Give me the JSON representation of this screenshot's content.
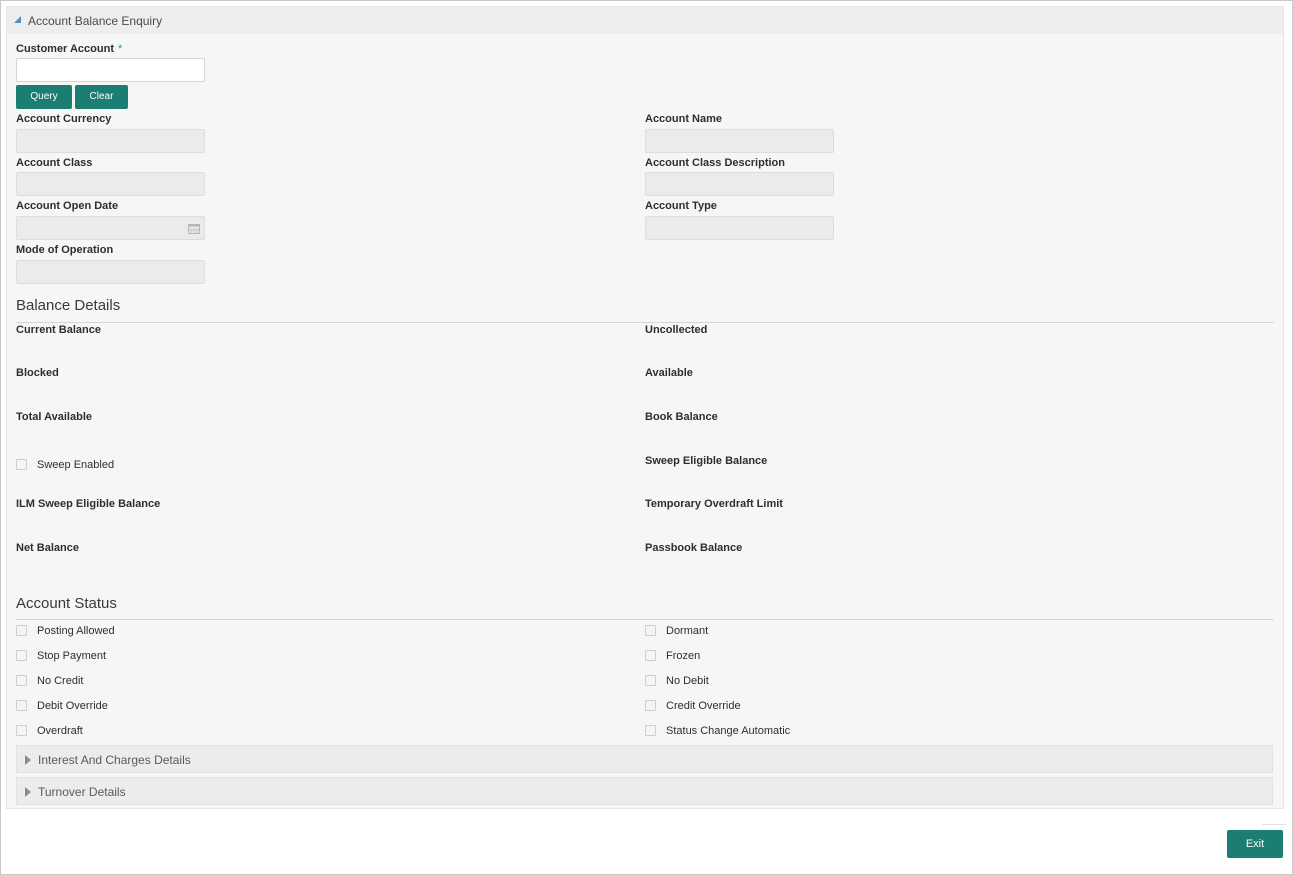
{
  "panel": {
    "title": "Account Balance Enquiry"
  },
  "customer_account": {
    "label": "Customer Account",
    "required_mark": "*",
    "value": ""
  },
  "buttons": {
    "query": "Query",
    "clear": "Clear",
    "exit": "Exit"
  },
  "fields": {
    "account_currency": {
      "label": "Account Currency",
      "value": ""
    },
    "account_name": {
      "label": "Account Name",
      "value": ""
    },
    "account_class": {
      "label": "Account Class",
      "value": ""
    },
    "account_class_description": {
      "label": "Account Class Description",
      "value": ""
    },
    "account_open_date": {
      "label": "Account Open Date",
      "value": ""
    },
    "account_type": {
      "label": "Account Type",
      "value": ""
    },
    "mode_of_operation": {
      "label": "Mode of Operation",
      "value": ""
    }
  },
  "balance_details": {
    "title": "Balance Details",
    "current_balance": "Current Balance",
    "uncollected": "Uncollected",
    "blocked": "Blocked",
    "available": "Available",
    "total_available": "Total Available",
    "book_balance": "Book Balance",
    "sweep_enabled": {
      "label": "Sweep Enabled",
      "checked": false
    },
    "sweep_eligible_balance": "Sweep Eligible Balance",
    "ilm_sweep_eligible_balance": "ILM Sweep Eligible Balance",
    "temporary_overdraft_limit": "Temporary Overdraft Limit",
    "net_balance": "Net Balance",
    "passbook_balance": "Passbook Balance"
  },
  "account_status": {
    "title": "Account Status",
    "left": [
      {
        "label": "Posting Allowed",
        "checked": false
      },
      {
        "label": "Stop Payment",
        "checked": false
      },
      {
        "label": "No Credit",
        "checked": false
      },
      {
        "label": "Debit Override",
        "checked": false
      },
      {
        "label": "Overdraft",
        "checked": false
      }
    ],
    "right": [
      {
        "label": "Dormant",
        "checked": false
      },
      {
        "label": "Frozen",
        "checked": false
      },
      {
        "label": "No Debit",
        "checked": false
      },
      {
        "label": "Credit Override",
        "checked": false
      },
      {
        "label": "Status Change Automatic",
        "checked": false
      }
    ]
  },
  "collapsibles": {
    "interest_charges": "Interest And Charges Details",
    "turnover": "Turnover Details"
  },
  "colors": {
    "accent": "#1c7d72",
    "header_triangle": "#5a8fb8"
  },
  "icons": {
    "panel_toggle": "triangle-down-icon",
    "calendar": "calendar-icon",
    "expand": "triangle-right-icon"
  }
}
